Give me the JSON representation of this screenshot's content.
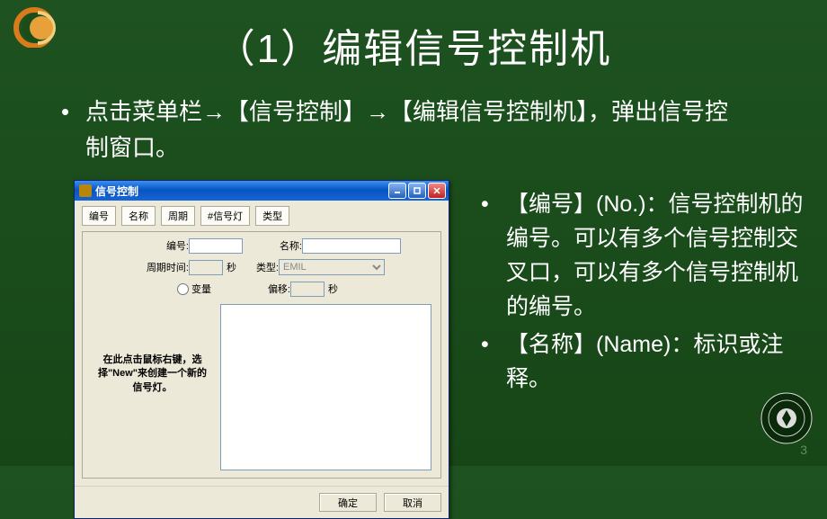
{
  "slide": {
    "title": "（1）编辑信号控制机",
    "intro_bullet": "•",
    "intro": "点击菜单栏→【信号控制】→【编辑信号控制机】，弹出信号控制窗口。",
    "page_number": "3"
  },
  "side": {
    "items": [
      {
        "bullet": "•",
        "text": "【编号】(No.)：信号控制机的编号。可以有多个信号控制交叉口，可以有多个信号控制机的编号。"
      },
      {
        "bullet": "•",
        "text": "【名称】(Name)：标识或注释。"
      }
    ]
  },
  "dialog": {
    "title": "信号控制",
    "tabs": [
      "编号",
      "名称",
      "周期",
      "#信号灯",
      "类型"
    ],
    "labels": {
      "no": "编号:",
      "name": "名称:",
      "cycle": "周期时间:",
      "sec": "秒",
      "type": "类型:",
      "variable": "变量",
      "offset": "偏移:",
      "sec2": "秒"
    },
    "type_value": "EMIL",
    "hint": "在此点击鼠标右键，选择\"New\"来创建一个新的信号灯。",
    "buttons": {
      "ok": "确定",
      "cancel": "取消"
    }
  }
}
